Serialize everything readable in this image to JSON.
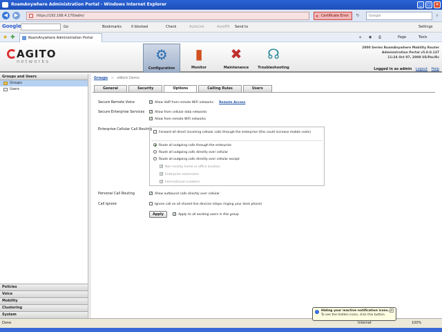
{
  "browser": {
    "title": "RoamAnywhere Administration Portal - Windows Internet Explorer",
    "url": "https://192.168.4.170/adm/",
    "cert_error": "Certificate Error",
    "search_placeholder": "Google",
    "google_label": "Google",
    "go_label": "Go",
    "bookmarks_label": "Bookmarks",
    "blocked_label": "0 blocked",
    "check_label": "Check",
    "autolink_label": "AutoLink",
    "autofill_label": "AutoFill",
    "sendto_label": "Send to",
    "settings_label": "Settings",
    "tab_title": "RoamAnywhere Administration Portal",
    "page_label": "Page",
    "tools_label": "Tools"
  },
  "app": {
    "logo_main": "AGITO",
    "logo_sub": "networks",
    "nav": [
      {
        "label": "Configuration",
        "icon": "gears-icon",
        "glyph": "⚙"
      },
      {
        "label": "Monitor",
        "icon": "bar-chart-icon",
        "glyph": "▮"
      },
      {
        "label": "Maintenance",
        "icon": "tools-icon",
        "glyph": "✖"
      },
      {
        "label": "Troubleshooting",
        "icon": "stethoscope-icon",
        "glyph": "☊"
      }
    ],
    "product_line1": "2000 Series RoamAnywhere Mobility Router",
    "product_line2": "Administration Portal v5.0.0.137",
    "product_line3": "11:24 Oct 07, 2008 US/Pacific",
    "logged_in": "Logged in as admin",
    "logout": "Logout",
    "help": "Help"
  },
  "sidebar": {
    "header": "Groups and Users",
    "items": [
      {
        "label": "Groups"
      },
      {
        "label": "Users"
      }
    ],
    "sections": [
      "Policies",
      "Voice",
      "Mobility",
      "Clustering",
      "System"
    ]
  },
  "content": {
    "breadcrumb_link": "Groups",
    "breadcrumb_sep": ">",
    "breadcrumb_current": "eWork Demo",
    "tabs": [
      "General",
      "Security",
      "Options",
      "Calling Rules",
      "Users"
    ],
    "secure_remote_voice": {
      "label": "Secure Remote Voice",
      "option": "Allow VoIP from remote WiFi networks",
      "link": "Remote Access"
    },
    "secure_enterprise": {
      "label": "Secure Enterprise Services",
      "option1": "Allow from cellular data networks",
      "option2": "Allow from remote WiFi networks"
    },
    "enterprise_cellular": {
      "label": "Enterprise Cellular Call Routing",
      "forward": "Forward all direct incoming cellular calls through the enterprise (this could increase mobile costs)",
      "radio1": "Route all outgoing calls through the enterprise",
      "radio2": "Route all outgoing calls directly over cellular",
      "radio3": "Route all outgoing calls directly over cellular except",
      "sub1": "Non-nearby home or office location",
      "sub2": "Enterprise extensions",
      "sub3": "International numbers"
    },
    "personal_call": {
      "label": "Personal Call Routing",
      "option": "Allow outbound calls directly over cellular"
    },
    "call_ignore": {
      "label": "Call Ignore",
      "option": "Ignore call on all shared line devices (stops ringing your desk phone)"
    },
    "apply_label": "Apply",
    "apply_all": "Apply to all existing users in this group"
  },
  "statusbar": {
    "text": "Done",
    "zone": "Internet",
    "zoom": "100%"
  },
  "balloon": {
    "title": "Hiding your inactive notification icons...",
    "body": "To see the hidden icons, click this button."
  }
}
